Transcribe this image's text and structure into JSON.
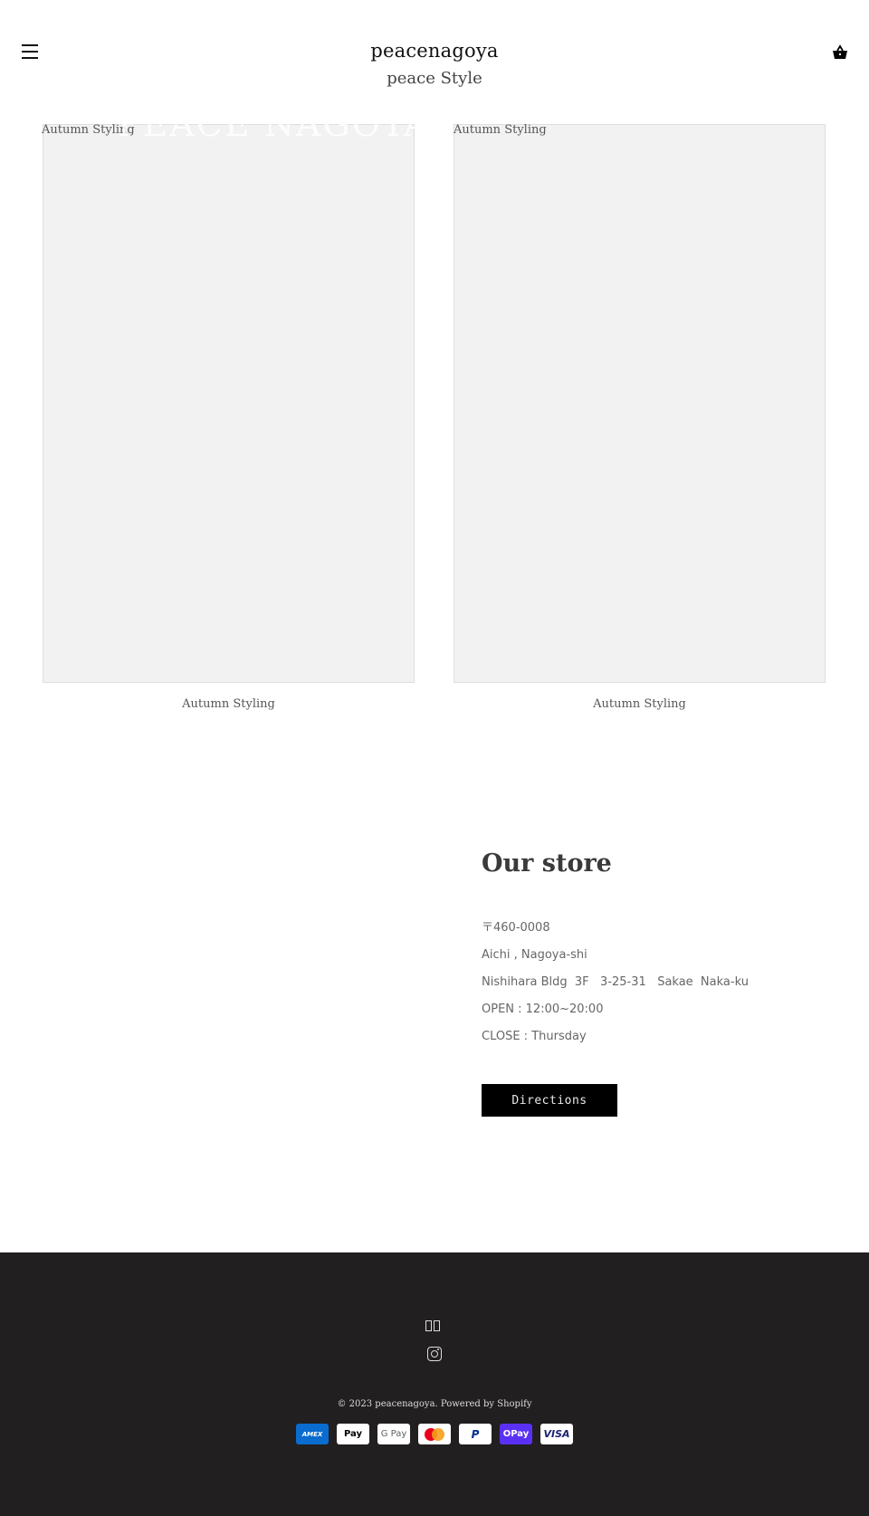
{
  "header": {
    "menu_icon": "hamburger-menu-icon",
    "brand": "peacenagoya",
    "tagline": "peace Style",
    "cart_icon": "shopping-basket-icon"
  },
  "watermark": "PEACE NAGOYA",
  "cards": [
    {
      "label": "Autumn Styling",
      "caption": "Autumn Styling"
    },
    {
      "label": "Autumn Styling",
      "caption": "Autumn Styling"
    }
  ],
  "store": {
    "title": "Our store",
    "lines": [
      "〒460-0008",
      "Aichi , Nagoya-shi",
      "Nishihara Bldg  3F   3-25-31   Sakae  Naka-ku",
      "OPEN : 12:00~20:00",
      "CLOSE : Thursday"
    ],
    "directions_label": "Directions"
  },
  "footer": {
    "glyph_icon": "missing-glyph-icon",
    "social_icon": "instagram-icon",
    "copyright": "© 2023 peacenagoya. Powered by Shopify",
    "payments": [
      {
        "name": "American Express",
        "label": "AMEX"
      },
      {
        "name": "Apple Pay",
        "label": " Pay"
      },
      {
        "name": "Google Pay",
        "label": "G Pay"
      },
      {
        "name": "Mastercard",
        "label": ""
      },
      {
        "name": "PayPal",
        "label": "P"
      },
      {
        "name": "Shop Pay",
        "label": "OPay"
      },
      {
        "name": "Visa",
        "label": "VISA"
      }
    ]
  }
}
